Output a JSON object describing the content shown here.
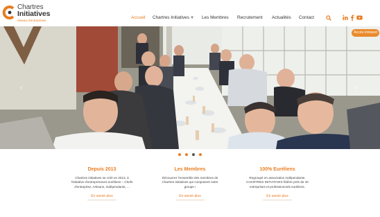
{
  "brand": {
    "line1": "Chartres",
    "line2": "Initiatives",
    "tagline": "réseau d'entreprises",
    "accent_color": "#e87d22"
  },
  "nav": {
    "items": [
      {
        "label": "Accueil",
        "active": true
      },
      {
        "label": "Chartres Initiatives",
        "active": false,
        "has_dropdown": true
      },
      {
        "label": "Les Membres",
        "active": false
      },
      {
        "label": "Recrutement",
        "active": false
      },
      {
        "label": "Actualités",
        "active": false
      },
      {
        "label": "Contact",
        "active": false
      }
    ],
    "search_icon": "search-icon",
    "social": [
      "linkedin-icon",
      "facebook-icon",
      "youtube-icon"
    ]
  },
  "hero": {
    "acces_label": "Accès Intranet",
    "prev_icon": "chevron-left-icon",
    "next_icon": "chevron-right-icon",
    "slides": 4,
    "active_slide": 3
  },
  "features": [
    {
      "title": "Depuis 2013",
      "lines": [
        "Chartres Initiatives se créé en 2013, à",
        "l'initiative d'entrepreneurs euréliens – Chefs",
        "d'entreprise, Artisans, Indépendants, ..."
      ],
      "link": "En savoir plus"
    },
    {
      "title": "Les Membres",
      "lines": [
        "Découvrez l'ensemble des membres de",
        "Chartres Initiatives qui composent notre",
        "groupe !"
      ],
      "link": "En savoir plus"
    },
    {
      "title": "100% Euréliens",
      "lines": [
        "Regroupé en association indépendante,",
        "CHARTRES INITIATIVES fédère près de 40",
        "entreprises et professionnels euréliens."
      ],
      "link": "En savoir plus"
    }
  ]
}
